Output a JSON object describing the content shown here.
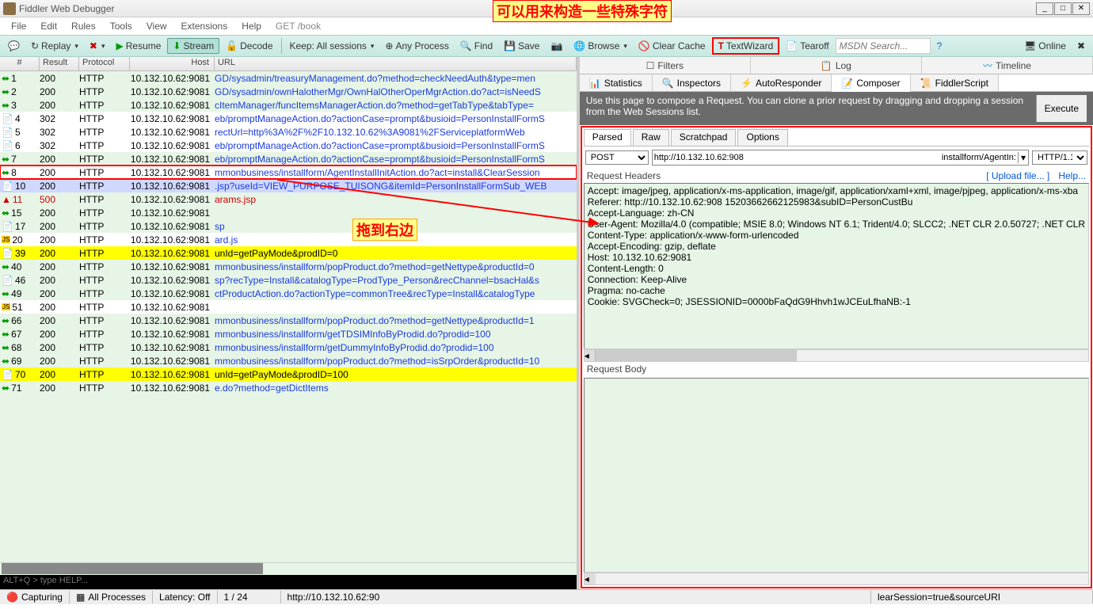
{
  "window": {
    "title": "Fiddler Web Debugger"
  },
  "menu": [
    "File",
    "Edit",
    "Rules",
    "Tools",
    "View",
    "Extensions",
    "Help",
    "GET /book"
  ],
  "toolbar": {
    "replay": "Replay",
    "x": "✖",
    "resume": "Resume",
    "stream": "Stream",
    "decode": "Decode",
    "keep": "Keep: All sessions",
    "anyproc": "Any Process",
    "find": "Find",
    "save": "Save",
    "browse": "Browse",
    "clear": "Clear Cache",
    "wizard": "TextWizard",
    "tearoff": "Tearoff",
    "search_ph": "MSDN Search...",
    "online": "Online"
  },
  "annotations": {
    "top": "可以用来构造一些特殊字符",
    "mid": "拖到右边"
  },
  "grid": {
    "headers": {
      "num": "#",
      "result": "Result",
      "protocol": "Protocol",
      "host": "Host",
      "url": "URL"
    },
    "rows": [
      {
        "n": "1",
        "res": "200",
        "p": "HTTP",
        "h": "10.132.10.62:9081",
        "u": "GD/sysadmin/treasuryManagement.do?method=checkNeedAuth&type=men",
        "ic": "g"
      },
      {
        "n": "2",
        "res": "200",
        "p": "HTTP",
        "h": "10.132.10.62:9081",
        "u": "GD/sysadmin/ownHalotherMgr/OwnHalOtherOperMgrAction.do?act=isNeedS",
        "ic": "g"
      },
      {
        "n": "3",
        "res": "200",
        "p": "HTTP",
        "h": "10.132.10.62:9081",
        "u": "cItemManager/funcItemsManagerAction.do?method=getTabType&tabType=",
        "ic": "g"
      },
      {
        "n": "4",
        "res": "302",
        "p": "HTTP",
        "h": "10.132.10.62:9081",
        "u": "eb/promptManageAction.do?actionCase=prompt&busioid=PersonInstallFormS",
        "ic": "b",
        "cls": "hl"
      },
      {
        "n": "5",
        "res": "302",
        "p": "HTTP",
        "h": "10.132.10.62:9081",
        "u": "rectUrl=http%3A%2F%2F10.132.10.62%3A9081%2FServiceplatformWeb",
        "ic": "d",
        "cls": "hl"
      },
      {
        "n": "6",
        "res": "302",
        "p": "HTTP",
        "h": "10.132.10.62:9081",
        "u": "eb/promptManageAction.do?actionCase=prompt&busioid=PersonInstallFormS",
        "ic": "d",
        "cls": "hl"
      },
      {
        "n": "7",
        "res": "200",
        "p": "HTTP",
        "h": "10.132.10.62:9081",
        "u": "eb/promptManageAction.do?actionCase=prompt&busioid=PersonInstallFormS",
        "ic": "g"
      },
      {
        "n": "8",
        "res": "200",
        "p": "HTTP",
        "h": "10.132.10.62:9081",
        "u": "mmonbusiness/installform/AgentInstallInitAction.do?act=install&ClearSession",
        "ic": "g",
        "cls": "sel"
      },
      {
        "n": "10",
        "res": "200",
        "p": "HTTP",
        "h": "10.132.10.62:9081",
        "u": ".jsp?useId=VIEW_PURPOSE_TUISONG&itemId=PersonInstallFormSub_WEB",
        "ic": "b",
        "cls": "blue"
      },
      {
        "n": "11",
        "res": "500",
        "p": "HTTP",
        "h": "10.132.10.62:9081",
        "u": "arams.jsp",
        "ic": "r",
        "red": true
      },
      {
        "n": "15",
        "res": "200",
        "p": "HTTP",
        "h": "10.132.10.62:9081",
        "u": "",
        "ic": "g"
      },
      {
        "n": "17",
        "res": "200",
        "p": "HTTP",
        "h": "10.132.10.62:9081",
        "u": "sp",
        "ic": "b"
      },
      {
        "n": "20",
        "res": "200",
        "p": "HTTP",
        "h": "10.132.10.62:9081",
        "u": "ard.js",
        "ic": "js",
        "cls": "hl"
      },
      {
        "n": "39",
        "res": "200",
        "p": "HTTP",
        "h": "10.132.10.62:9081",
        "u": "unId=getPayMode&prodID=0",
        "ic": "b",
        "cls": "yellow",
        "black": true
      },
      {
        "n": "40",
        "res": "200",
        "p": "HTTP",
        "h": "10.132.10.62:9081",
        "u": "mmonbusiness/installform/popProduct.do?method=getNettype&productId=0",
        "ic": "g"
      },
      {
        "n": "46",
        "res": "200",
        "p": "HTTP",
        "h": "10.132.10.62:9081",
        "u": "sp?recType=Install&catalogType=ProdType_Person&recChannel=bsacHal&s",
        "ic": "b"
      },
      {
        "n": "49",
        "res": "200",
        "p": "HTTP",
        "h": "10.132.10.62:9081",
        "u": "ctProductAction.do?actionType=commonTree&recType=Install&catalogType",
        "ic": "g"
      },
      {
        "n": "51",
        "res": "200",
        "p": "HTTP",
        "h": "10.132.10.62:9081",
        "u": "",
        "ic": "js",
        "cls": "hl"
      },
      {
        "n": "66",
        "res": "200",
        "p": "HTTP",
        "h": "10.132.10.62:9081",
        "u": "mmonbusiness/installform/popProduct.do?method=getNettype&productId=1",
        "ic": "g"
      },
      {
        "n": "67",
        "res": "200",
        "p": "HTTP",
        "h": "10.132.10.62:9081",
        "u": "mmonbusiness/installform/getTDSIMInfoByProdid.do?prodid=100",
        "ic": "g"
      },
      {
        "n": "68",
        "res": "200",
        "p": "HTTP",
        "h": "10.132.10.62:9081",
        "u": "mmonbusiness/installform/getDummyInfoByProdid.do?prodid=100",
        "ic": "g"
      },
      {
        "n": "69",
        "res": "200",
        "p": "HTTP",
        "h": "10.132.10.62:9081",
        "u": "mmonbusiness/installform/popProduct.do?method=isSrpOrder&productId=10",
        "ic": "g"
      },
      {
        "n": "70",
        "res": "200",
        "p": "HTTP",
        "h": "10.132.10.62:9081",
        "u": "unId=getPayMode&prodID=100",
        "ic": "b",
        "cls": "yellow",
        "black": true
      },
      {
        "n": "71",
        "res": "200",
        "p": "HTTP",
        "h": "10.132.10.62:9081",
        "u": "e.do?method=getDictItems",
        "ic": "g"
      }
    ]
  },
  "cmd": "ALT+Q > type HELP...",
  "right": {
    "tabs1": [
      "Filters",
      "Log",
      "Timeline"
    ],
    "tabs2": [
      "Statistics",
      "Inspectors",
      "AutoResponder",
      "Composer",
      "FiddlerScript"
    ],
    "info": "Use this page to compose a Request. You can clone a prior request by dragging and dropping a session from the Web Sessions list.",
    "execute": "Execute",
    "subtabs": [
      "Parsed",
      "Raw",
      "Scratchpad",
      "Options"
    ],
    "method": "POST",
    "url_a": "http://10.132.10.62:908",
    "url_b": "installform/AgentIn:",
    "ver": "HTTP/1.1",
    "reqhdr_label": "Request Headers",
    "upload": "[ Upload file... ]",
    "help": "Help...",
    "headers": [
      "Accept: image/jpeg, application/x-ms-application, image/gif, application/xaml+xml, image/pjpeg, application/x-ms-xba",
      "Referer: http://10.132.10.62:908                                                              15203662662125983&subID=PersonCustBu",
      "Accept-Language: zh-CN",
      "User-Agent: Mozilla/4.0 (compatible; MSIE 8.0; Windows NT 6.1; Trident/4.0; SLCC2; .NET CLR 2.0.50727; .NET CLR",
      "Content-Type: application/x-www-form-urlencoded",
      "Accept-Encoding: gzip, deflate",
      "Host: 10.132.10.62:9081",
      "Content-Length: 0",
      "Connection: Keep-Alive",
      "Pragma: no-cache",
      "Cookie: SVGCheck=0;                                                     JSESSIONID=0000bFaQdG9Hhvh1wJCEuLfhaNB:-1"
    ],
    "reqbody_label": "Request Body"
  },
  "status": {
    "capturing": "Capturing",
    "allproc": "All Processes",
    "latency": "Latency: Off",
    "count": "1 / 24",
    "url": "http://10.132.10.62:90",
    "url2": "learSession=true&sourceURI"
  }
}
